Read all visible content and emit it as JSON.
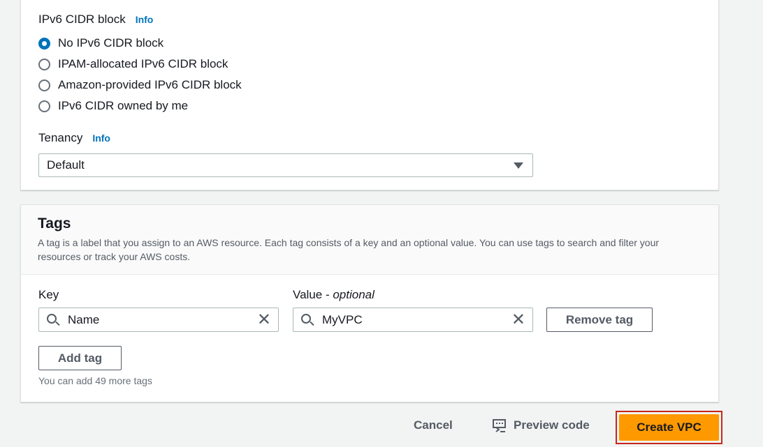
{
  "ipv6": {
    "label": "IPv6 CIDR block",
    "info": "Info",
    "options": [
      "No IPv6 CIDR block",
      "IPAM-allocated IPv6 CIDR block",
      "Amazon-provided IPv6 CIDR block",
      "IPv6 CIDR owned by me"
    ],
    "selected": 0
  },
  "tenancy": {
    "label": "Tenancy",
    "info": "Info",
    "value": "Default"
  },
  "tags": {
    "title": "Tags",
    "description": "A tag is a label that you assign to an AWS resource. Each tag consists of a key and an optional value. You can use tags to search and filter your resources or track your AWS costs.",
    "key_label": "Key",
    "value_label": "Value - ",
    "value_optional": "optional",
    "key": "Name",
    "value": "MyVPC",
    "remove": "Remove tag",
    "add": "Add tag",
    "hint": "You can add 49 more tags"
  },
  "footer": {
    "cancel": "Cancel",
    "preview": "Preview code",
    "create": "Create VPC"
  },
  "colors": {
    "primary": "#ff9900",
    "link": "#0073bb",
    "highlight": "#c7261b"
  }
}
